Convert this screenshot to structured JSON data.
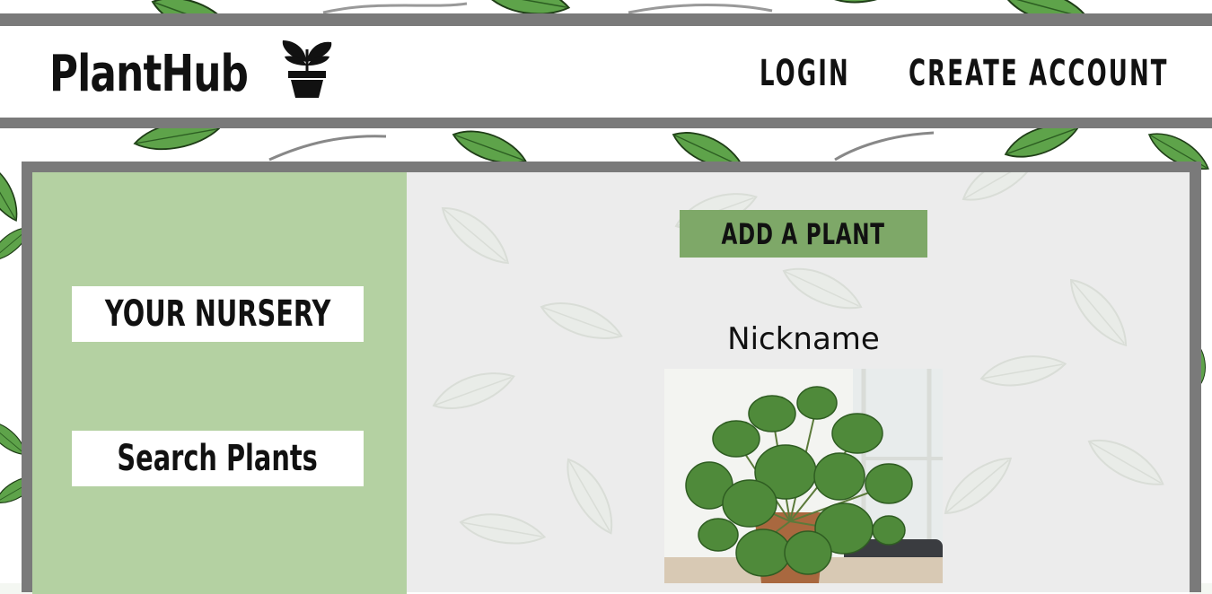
{
  "app": {
    "brand_name": "PlantHub",
    "brand_icon": "potted-plant-icon"
  },
  "nav": {
    "login_label": "LOGIN",
    "create_account_label": "CREATE ACCOUNT"
  },
  "sidebar": {
    "items": [
      {
        "label": "YOUR NURSERY"
      },
      {
        "label": "Search Plants"
      }
    ]
  },
  "main": {
    "add_button_label": "ADD A PLANT",
    "plant_card": {
      "nickname": "Nickname",
      "image_icon": "plant-photo"
    }
  },
  "colors": {
    "stripe": "#7a7a7a",
    "sidebar_bg": "#b4d1a2",
    "add_button_bg": "#7ea868",
    "text": "#111111"
  }
}
